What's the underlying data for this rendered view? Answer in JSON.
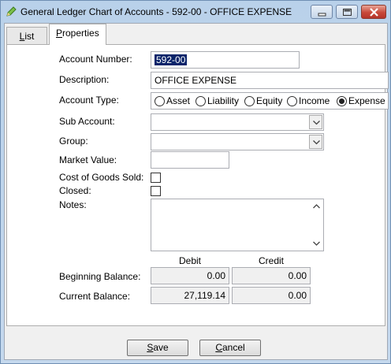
{
  "window": {
    "title": "General Ledger Chart of Accounts - 592-00 - OFFICE EXPENSE"
  },
  "tabs": {
    "list_first": "L",
    "list_rest": "ist",
    "properties_first": "P",
    "properties_rest": "roperties",
    "active": "Properties"
  },
  "form": {
    "account_number_label": "Account Number:",
    "account_number": "592-00",
    "description_label": "Description:",
    "description": "OFFICE EXPENSE",
    "account_type_label": "Account Type:",
    "account_types": [
      "Asset",
      "Liability",
      "Equity",
      "Income",
      "Expense"
    ],
    "account_type_selected": "Expense",
    "sub_account_label": "Sub Account:",
    "sub_account": "",
    "group_label": "Group:",
    "group": "",
    "market_value_label": "Market Value:",
    "market_value": "",
    "cogs_label": "Cost of Goods Sold:",
    "cogs_checked": false,
    "closed_label": "Closed:",
    "closed_checked": false,
    "notes_label": "Notes:",
    "notes": ""
  },
  "balances": {
    "debit_header": "Debit",
    "credit_header": "Credit",
    "beginning_label": "Beginning Balance:",
    "beginning_debit": "0.00",
    "beginning_credit": "0.00",
    "current_label": "Current Balance:",
    "current_debit": "27,119.14",
    "current_credit": "0.00"
  },
  "buttons": {
    "save_first": "S",
    "save_rest": "ave",
    "cancel_first": "C",
    "cancel_rest": "ancel"
  },
  "colors": {
    "selection": "#0a246a",
    "titlebar": "#b9d1ea",
    "close_button": "#c8493a"
  },
  "icons": {
    "app": "pencil-icon",
    "minimize": "minimize-icon",
    "maximize": "maximize-icon",
    "close": "close-icon"
  }
}
